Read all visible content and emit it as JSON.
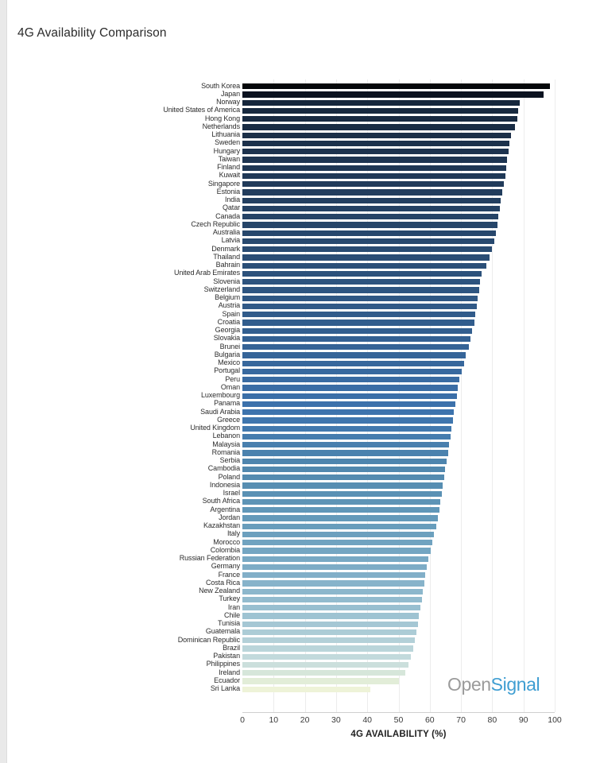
{
  "chart_data": {
    "type": "bar",
    "orientation": "horizontal",
    "title": "4G Availability Comparison",
    "xlabel": "4G AVAILABILITY (%)",
    "ylabel": "",
    "xlim": [
      0,
      100
    ],
    "xticks": [
      0,
      10,
      20,
      30,
      40,
      50,
      60,
      70,
      80,
      90,
      100
    ],
    "grid": true,
    "grid_axis": "x",
    "legend": "none",
    "watermark": {
      "prefix": "Open",
      "suffix": "Signal"
    },
    "categories": [
      "South Korea",
      "Japan",
      "Norway",
      "United States of America",
      "Hong Kong",
      "Netherlands",
      "Lithuania",
      "Sweden",
      "Hungary",
      "Taiwan",
      "Finland",
      "Kuwait",
      "Singapore",
      "Estonia",
      "India",
      "Qatar",
      "Canada",
      "Czech Republic",
      "Australia",
      "Latvia",
      "Denmark",
      "Thailand",
      "Bahrain",
      "United Arab Emirates",
      "Slovenia",
      "Switzerland",
      "Belgium",
      "Austria",
      "Spain",
      "Croatia",
      "Georgia",
      "Slovakia",
      "Brunei",
      "Bulgaria",
      "Mexico",
      "Portugal",
      "Peru",
      "Oman",
      "Luxembourg",
      "Panama",
      "Saudi Arabia",
      "Greece",
      "United Kingdom",
      "Lebanon",
      "Malaysia",
      "Romania",
      "Serbia",
      "Cambodia",
      "Poland",
      "Indonesia",
      "Israel",
      "South Africa",
      "Argentina",
      "Jordan",
      "Kazakhstan",
      "Italy",
      "Morocco",
      "Colombia",
      "Russian Federation",
      "Germany",
      "France",
      "Costa Rica",
      "New Zealand",
      "Turkey",
      "Iran",
      "Chile",
      "Tunisia",
      "Guatemala",
      "Dominican Republic",
      "Brazil",
      "Pakistan",
      "Philippines",
      "Ireland",
      "Ecuador",
      "Sri Lanka"
    ],
    "values": [
      98.5,
      96.4,
      88.9,
      88.4,
      88.0,
      87.4,
      86.0,
      85.6,
      85.2,
      84.8,
      84.4,
      84.1,
      83.6,
      83.2,
      82.8,
      82.4,
      82.0,
      81.6,
      81.2,
      80.6,
      80.0,
      79.2,
      78.0,
      76.6,
      76.2,
      75.8,
      75.4,
      75.0,
      74.6,
      74.2,
      73.6,
      73.0,
      72.4,
      71.6,
      71.0,
      70.2,
      69.4,
      69.0,
      68.6,
      68.2,
      67.8,
      67.4,
      67.0,
      66.6,
      66.2,
      65.8,
      65.4,
      65.0,
      64.6,
      64.2,
      63.8,
      63.4,
      63.0,
      62.6,
      62.0,
      61.4,
      60.8,
      60.2,
      59.6,
      59.0,
      58.6,
      58.2,
      57.8,
      57.4,
      57.0,
      56.6,
      56.2,
      55.8,
      55.2,
      54.6,
      54.0,
      53.2,
      52.2,
      50.0,
      41.0
    ],
    "colors": [
      "#05070a",
      "#0b1220",
      "#15263c",
      "#17293f",
      "#182a41",
      "#192c44",
      "#1b2f48",
      "#1c314b",
      "#1d334e",
      "#1e3551",
      "#1f3754",
      "#203957",
      "#213b5a",
      "#223d5d",
      "#233f60",
      "#244163",
      "#254366",
      "#264569",
      "#27476c",
      "#28496f",
      "#294b72",
      "#2a4d75",
      "#2b4f78",
      "#2c517b",
      "#2d537e",
      "#2e5581",
      "#2f5784",
      "#305987",
      "#315b8a",
      "#325d8d",
      "#335f90",
      "#346193",
      "#356396",
      "#366599",
      "#37679c",
      "#38699f",
      "#396ba2",
      "#3a6da5",
      "#3b6fa8",
      "#3c71ab",
      "#3d73ad",
      "#3f76ae",
      "#4279ae",
      "#457cae",
      "#487fae",
      "#4b82ae",
      "#4e85ae",
      "#5188ae",
      "#548bb0",
      "#578eb2",
      "#5a91b4",
      "#5d94b6",
      "#6097b8",
      "#649aba",
      "#689dbc",
      "#6ca0be",
      "#70a3c0",
      "#74a6c2",
      "#78a9c4",
      "#7dacc6",
      "#82afc8",
      "#87b3ca",
      "#8cb7cc",
      "#92bbce",
      "#98bfd0",
      "#9ec3d2",
      "#a5c7d4",
      "#acccd6",
      "#b3d0d8",
      "#bad5da",
      "#c2dadc",
      "#cbdfdc",
      "#d6e6da",
      "#e2edd8",
      "#eef3d8"
    ]
  }
}
